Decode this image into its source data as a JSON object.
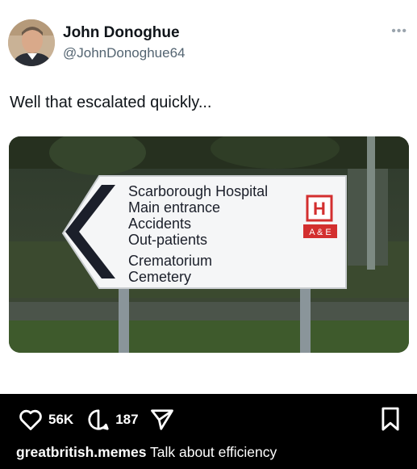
{
  "author": {
    "name": "John Donoghue",
    "handle": "@JohnDonoghue64"
  },
  "more_icon": "more-horizontal-icon",
  "post_text": "Well that escalated quickly...",
  "sign": {
    "lines_top": [
      "Scarborough Hospital",
      "Main entrance",
      "Accidents",
      "Out-patients"
    ],
    "lines_bottom": [
      "Crematorium",
      "Cemetery"
    ],
    "hospital_symbol": "H",
    "ae_label": "A & E",
    "sign_color": "#ffffff",
    "text_color": "#1b1f2a",
    "accent_color": "#d32f2f"
  },
  "actions": {
    "likes": "56K",
    "comments": "187",
    "like_icon": "heart-icon",
    "comment_icon": "comment-bubble-icon",
    "share_icon": "send-icon",
    "save_icon": "bookmark-icon"
  },
  "caption": {
    "username": "greatbritish.memes",
    "text": "Talk about efficiency"
  }
}
